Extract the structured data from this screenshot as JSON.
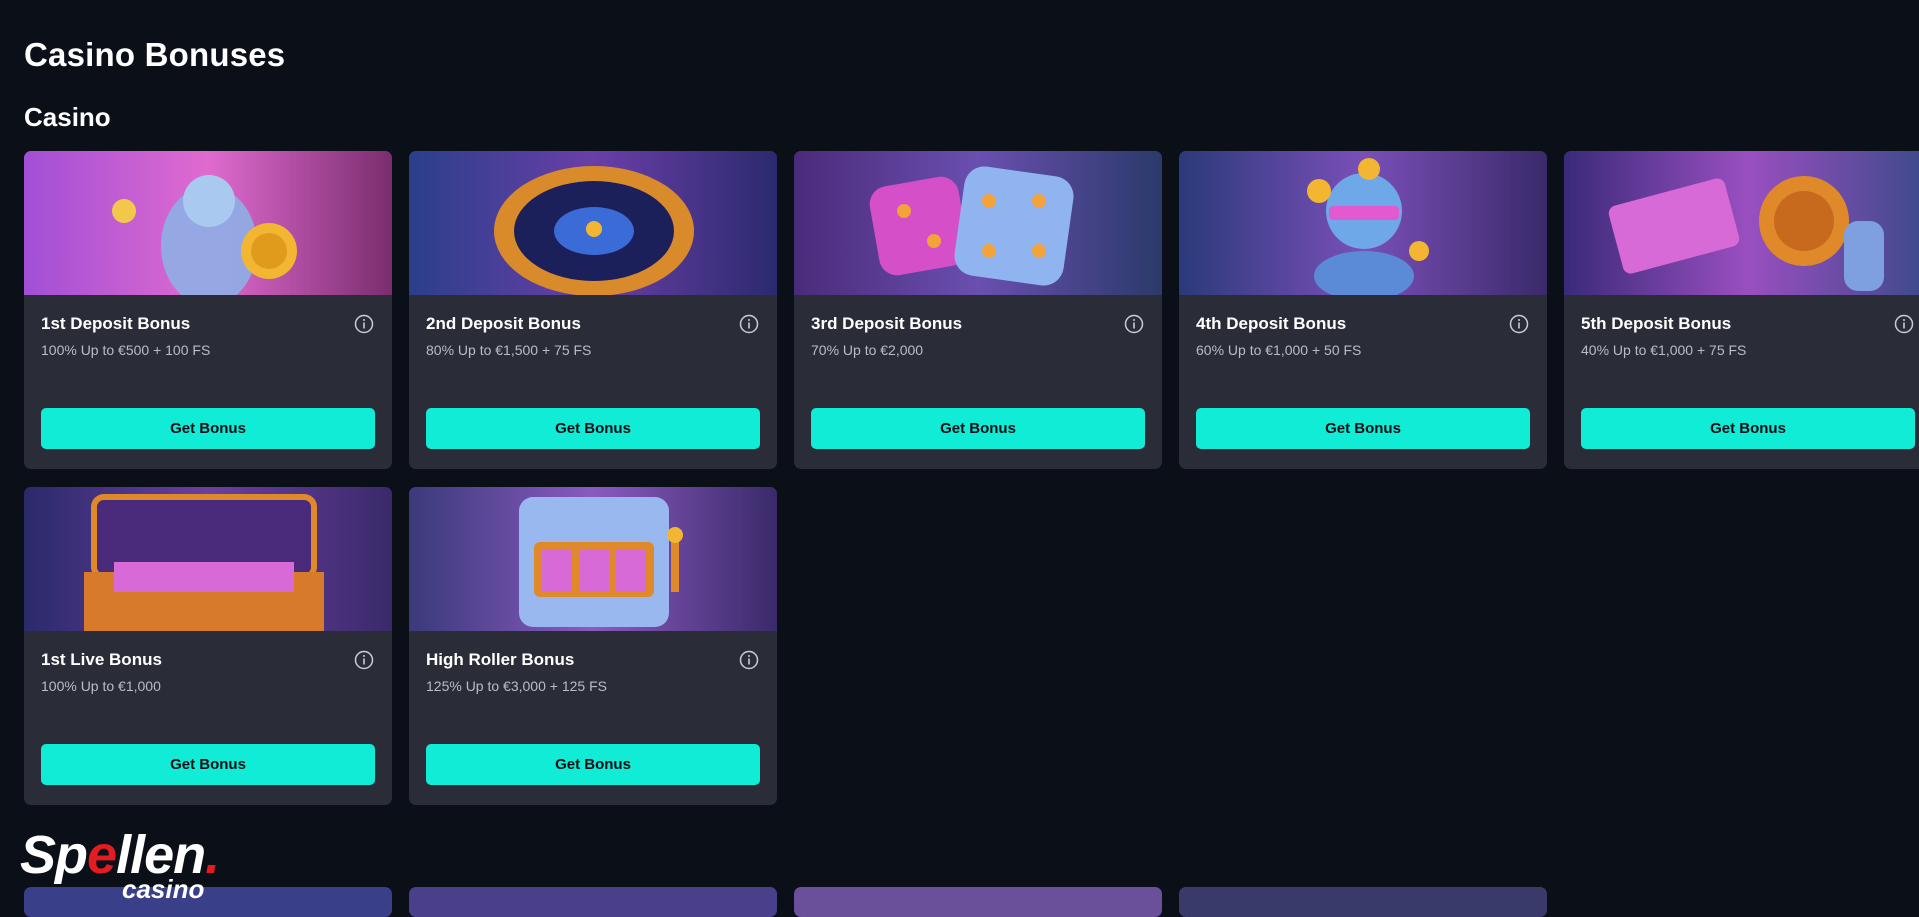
{
  "page": {
    "title": "Casino Bonuses"
  },
  "section": {
    "title": "Casino"
  },
  "cards": [
    {
      "title": "1st Deposit Bonus",
      "subtitle": "100% Up to €500 + 100 FS",
      "button": "Get Bonus",
      "image": "statue-with-gold-coin"
    },
    {
      "title": "2nd Deposit Bonus",
      "subtitle": "80% Up to €1,500 + 75 FS",
      "button": "Get Bonus",
      "image": "roulette-wheel"
    },
    {
      "title": "3rd Deposit Bonus",
      "subtitle": "70% Up to €2,000",
      "button": "Get Bonus",
      "image": "dice"
    },
    {
      "title": "4th Deposit Bonus",
      "subtitle": "60% Up to €1,000 + 50 FS",
      "button": "Get Bonus",
      "image": "statue-with-coins"
    },
    {
      "title": "5th Deposit Bonus",
      "subtitle": "40% Up to €1,000 + 75 FS",
      "button": "Get Bonus",
      "image": "hand-with-cash-and-coin"
    },
    {
      "title": "1st Live Bonus",
      "subtitle": "100% Up to €1,000",
      "button": "Get Bonus",
      "image": "treasure-chest-with-cash"
    },
    {
      "title": "High Roller Bonus",
      "subtitle": "125% Up to €3,000 + 125 FS",
      "button": "Get Bonus",
      "image": "slot-machine"
    }
  ],
  "logo": {
    "main_before": "Sp",
    "main_red": "e",
    "main_after": "llen",
    "dot": ".",
    "sub": "casino"
  },
  "colors": {
    "background": "#0b0f17",
    "card": "#2a2d38",
    "accent": "#10ecd5",
    "logo_red": "#e31b23"
  }
}
